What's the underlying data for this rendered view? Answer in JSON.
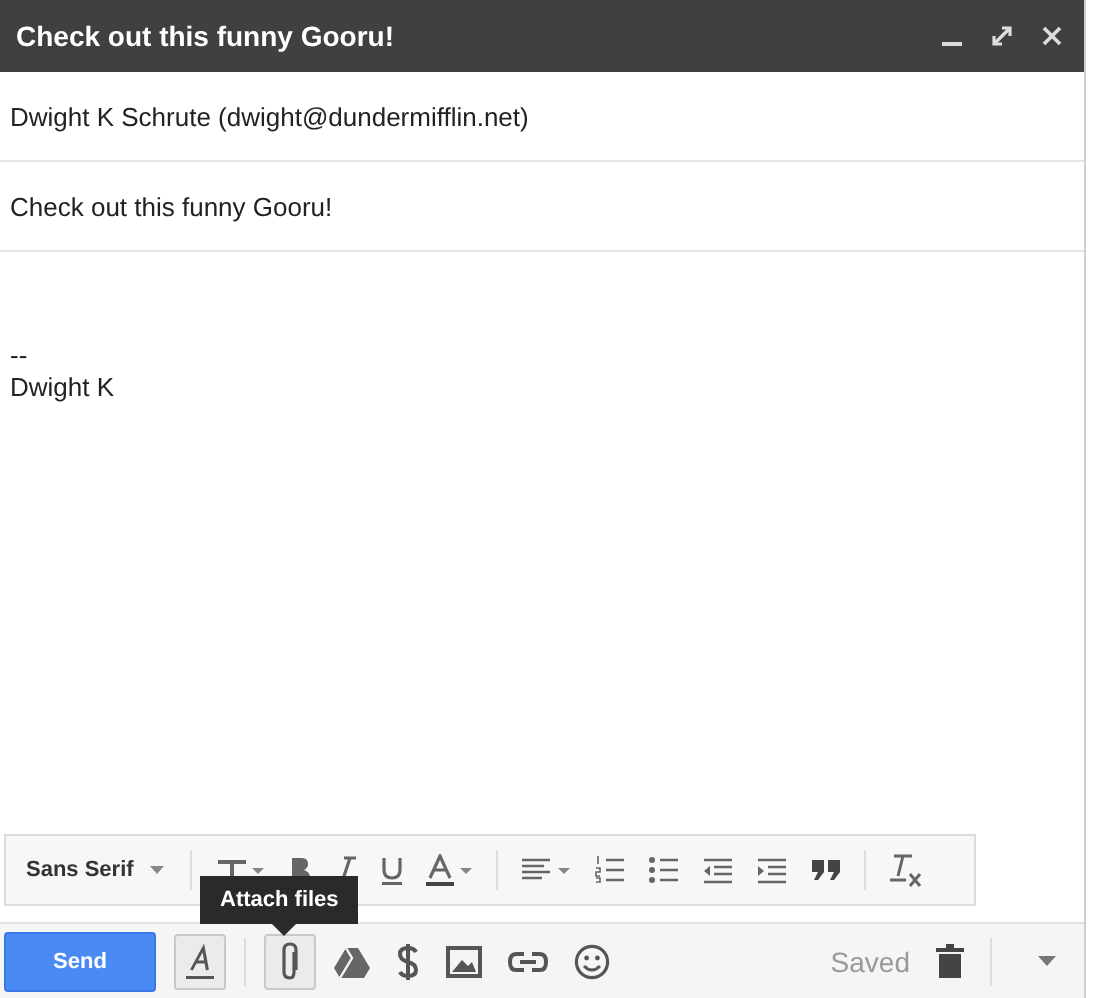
{
  "window": {
    "title": "Check out this funny Gooru!"
  },
  "to": {
    "value": "Dwight K Schrute (dwight@dundermifflin.net)"
  },
  "subject": {
    "value": "Check out this funny Gooru!"
  },
  "body": {
    "lines": [
      "--",
      "Dwight K"
    ]
  },
  "format_bar": {
    "font": "Sans Serif"
  },
  "tooltip": {
    "text": "Attach files"
  },
  "bottom_bar": {
    "send": "Send",
    "status": "Saved",
    "format_selected": true,
    "attach_hovered": true
  }
}
